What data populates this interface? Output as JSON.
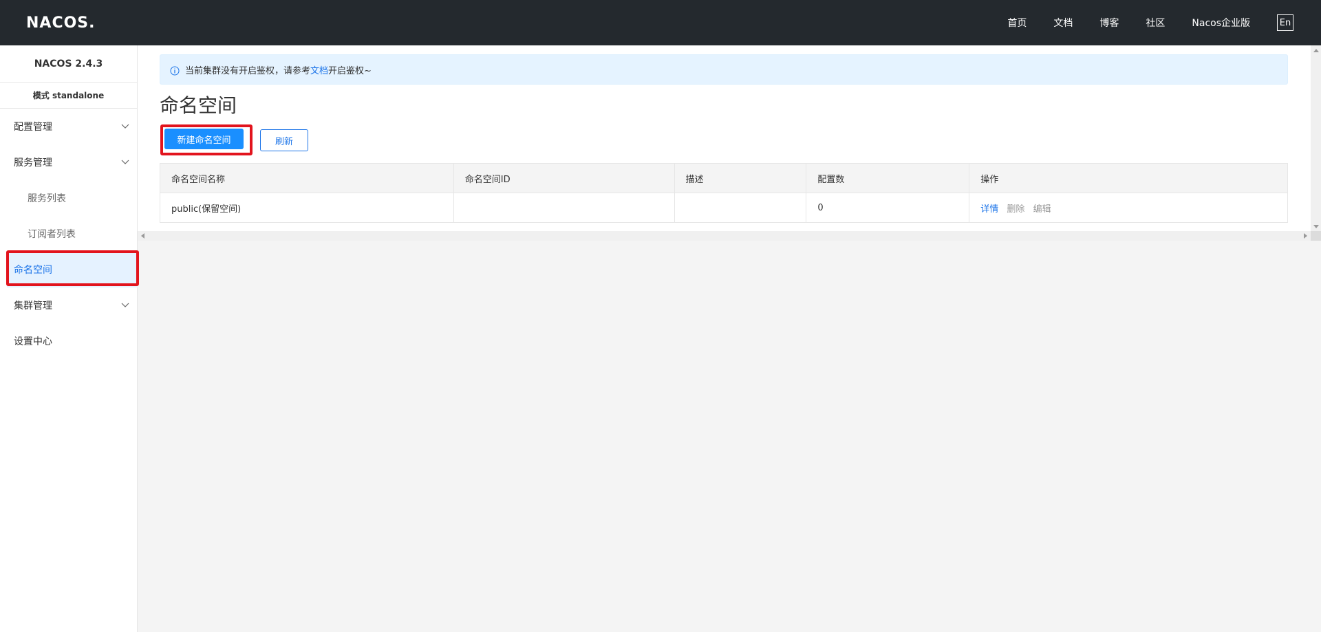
{
  "header": {
    "logo_text": "NACOS",
    "logo_dot": ".",
    "nav": [
      "首页",
      "文档",
      "博客",
      "社区",
      "Nacos企业版"
    ],
    "lang": "En"
  },
  "sidebar": {
    "version": "NACOS 2.4.3",
    "mode": "模式 standalone",
    "items": [
      {
        "label": "配置管理",
        "chevron": "chevron-down-icon"
      },
      {
        "label": "服务管理",
        "chevron": "chevron-down-icon"
      },
      {
        "label": "服务列表"
      },
      {
        "label": "订阅者列表"
      },
      {
        "label": "命名空间",
        "active": true
      },
      {
        "label": "集群管理",
        "chevron": "chevron-down-icon"
      },
      {
        "label": "设置中心"
      }
    ]
  },
  "notice": {
    "icon": "info-icon",
    "prefix": "当前集群没有开启鉴权，请参考",
    "link": "文档",
    "suffix": "开启鉴权~"
  },
  "page": {
    "title": "命名空间",
    "create_button": "新建命名空间",
    "refresh_button": "刷新"
  },
  "table": {
    "columns": [
      "命名空间名称",
      "命名空间ID",
      "描述",
      "配置数",
      "操作"
    ],
    "rows": [
      {
        "name": "public(保留空间)",
        "id": "",
        "description": "",
        "config_count": "0",
        "actions": [
          "详情",
          "删除",
          "编辑"
        ]
      }
    ]
  },
  "colors": {
    "header_bg": "#24292e",
    "primary": "#1a8fff",
    "link": "#1a73e8",
    "highlight": "#e2141d"
  }
}
